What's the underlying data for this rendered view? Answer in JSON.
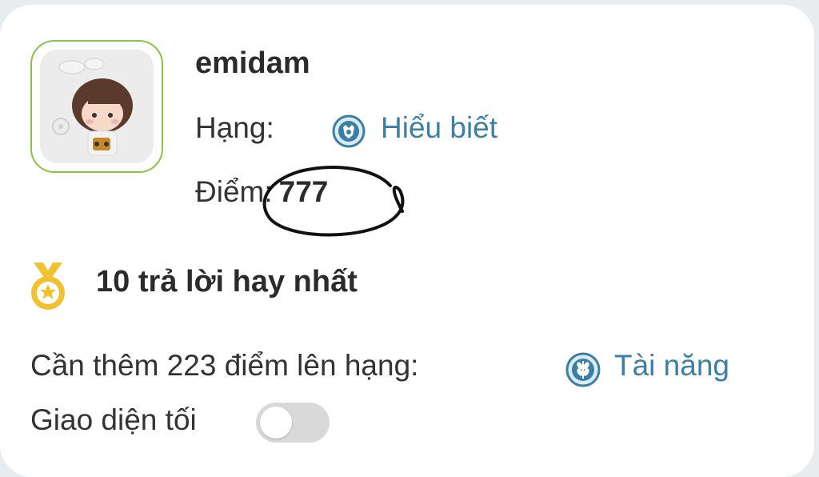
{
  "profile": {
    "username": "emidam",
    "rank_label": "Hạng:",
    "rank_name": "Hiểu biết",
    "rank_icon": "shield-badge-icon",
    "points_label": "Điểm:",
    "points_value": "777"
  },
  "achievement": {
    "icon": "medal-icon",
    "text": "10 trả lời hay nhất"
  },
  "next_rank": {
    "text": "Cần thêm 223 điểm lên hạng:",
    "rank_name": "Tài năng",
    "rank_icon": "wheat-badge-icon"
  },
  "dark_mode": {
    "label": "Giao diện tối",
    "enabled": false
  },
  "colors": {
    "rank_text": "#3c7fa5",
    "avatar_border": "#8bc34a",
    "medal": "#f2c12e",
    "toggle_off": "#d9d9d9"
  }
}
